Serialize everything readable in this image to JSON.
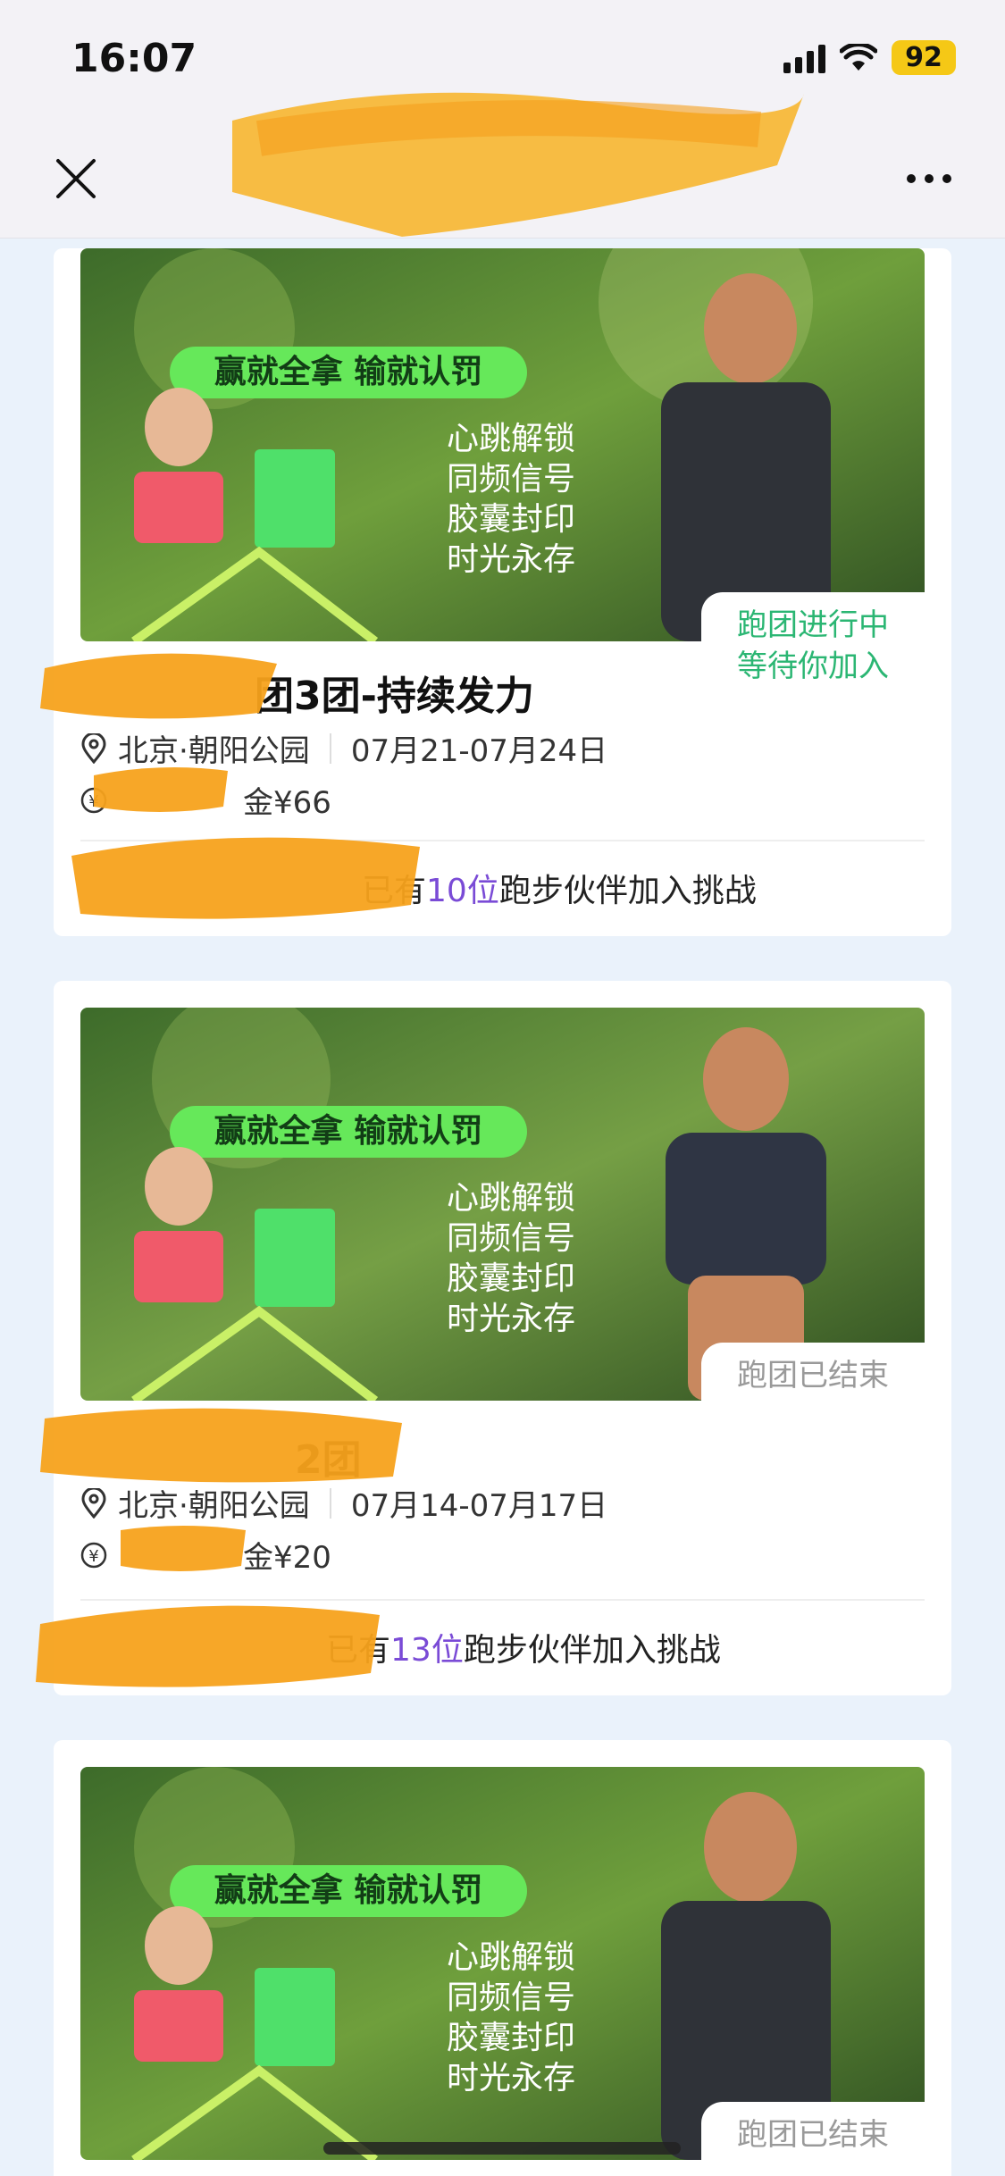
{
  "status_bar": {
    "time": "16:07",
    "battery": "92"
  },
  "nav": {
    "title": "",
    "subtitle": "",
    "close_icon": "close-icon",
    "more_icon": "more-icon"
  },
  "banner_text": {
    "slogan": "赢就全拿  输就认罚",
    "lines": [
      "心跳解锁",
      "同频信号",
      "胶囊封印",
      "时光永存"
    ]
  },
  "cards": [
    {
      "status_lines": [
        "跑团进行中",
        "等待你加入"
      ],
      "status_color": "#2bb673",
      "title": "团3团-持续发力",
      "location": "北京·朝阳公园",
      "dates": "07月21-07月24日",
      "fee": "金¥66",
      "join_prefix": "已有",
      "join_count": "10位",
      "join_suffix": "跑步伙伴加入挑战"
    },
    {
      "status_lines": [
        "跑团已结束"
      ],
      "status_color": "#9a9a9a",
      "title": "2团",
      "location": "北京·朝阳公园",
      "dates": "07月14-07月17日",
      "fee": "金¥20",
      "join_prefix": "已有",
      "join_count": "13位",
      "join_suffix": "跑步伙伴加入挑战"
    },
    {
      "status_lines": [
        "跑团已结束"
      ],
      "status_color": "#9a9a9a"
    }
  ],
  "colors": {
    "accent_purple": "#7a4bd6",
    "banner_green": "#66e85a",
    "redaction": "#f6a623"
  }
}
